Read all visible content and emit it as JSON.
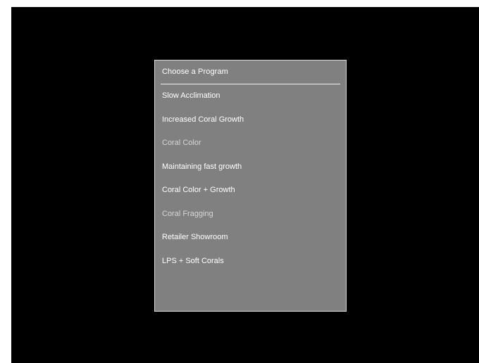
{
  "dialog": {
    "title": "Choose a Program",
    "programs": [
      {
        "label": "Slow Acclimation"
      },
      {
        "label": "Increased Coral Growth"
      },
      {
        "label": "Coral Color"
      },
      {
        "label": "Maintaining fast growth"
      },
      {
        "label": "Coral Color + Growth"
      },
      {
        "label": "Coral Fragging"
      },
      {
        "label": "Retailer Showroom"
      },
      {
        "label": "LPS + Soft Corals"
      }
    ]
  },
  "colors": {
    "screen_background": "#000000",
    "dialog_background": "#808080",
    "text": "#ffffff",
    "divider": "#f2f2f2"
  }
}
